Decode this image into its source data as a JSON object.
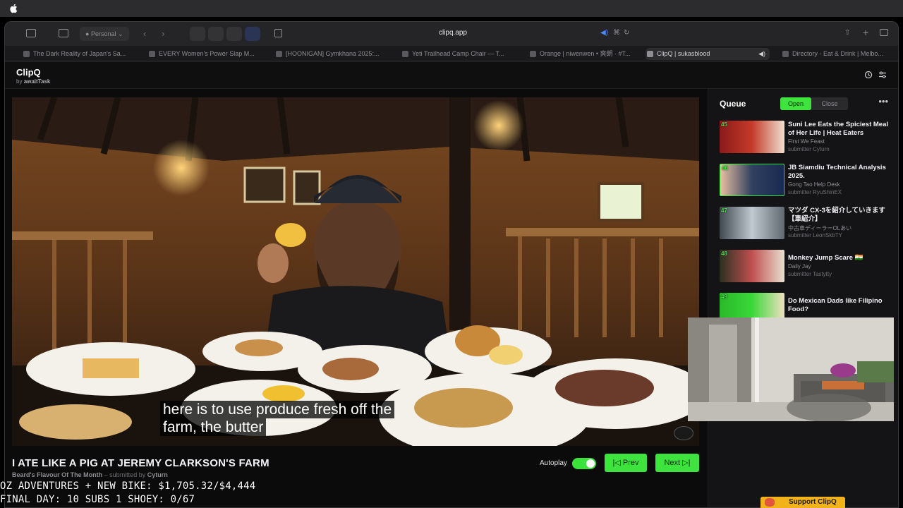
{
  "browser": {
    "profile_label": "Personal",
    "url": "clipq.app",
    "tabs": [
      {
        "label": "The Dark Reality of Japan's Sa..."
      },
      {
        "label": "EVERY Women's Power Slap M..."
      },
      {
        "label": "[HOONIGAN] Gymkhana 2025:..."
      },
      {
        "label": "Yeti Trailhead Camp Chair — T..."
      },
      {
        "label": "Orange | niwenwen • 爽朗 · #T..."
      },
      {
        "label": "ClipQ | sukasblood"
      },
      {
        "label": "Directory - Eat & Drink | Melbo..."
      }
    ]
  },
  "app": {
    "name": "ClipQ",
    "by_prefix": "by",
    "by_author": "awaitTask"
  },
  "video": {
    "caption_line1": "here is to use produce fresh off the",
    "caption_line2": "farm, the butter",
    "title": "I ATE LIKE A PIG AT JEREMY CLARKSON'S FARM",
    "channel": "Beard's Flavour Of The Month",
    "submitted_by_label": "– submitted by",
    "submitter": "Cyturn",
    "autoplay_label": "Autoplay",
    "autoplay_on": true,
    "prev_label": "Prev",
    "next_label": "Next"
  },
  "queue": {
    "title": "Queue",
    "open_label": "Open",
    "close_label": "Close",
    "items": [
      {
        "num": "45",
        "title": "Suni Lee Eats the Spiciest Meal of Her Life | Heat Eaters",
        "channel": "First We Feast",
        "submitter": "submitter Cyturn"
      },
      {
        "num": "46",
        "title": "JB Siamdiu Technical Analysis 2025.",
        "channel": "Gong Tao Help Desk",
        "submitter": "submitter RyuShinEX"
      },
      {
        "num": "47",
        "title": "マツダ CX-3を紹介していきます【車紹介】",
        "channel": "中古車ディーラーOLあい",
        "submitter": "submitter LeonSkbTY"
      },
      {
        "num": "48",
        "title": "Monkey Jump Scare 🇮🇳",
        "channel": "Daily Jay",
        "submitter": "submitter Tastytty"
      },
      {
        "num": "49",
        "title": "Do Mexican Dads like Filipino Food?",
        "channel": "",
        "submitter": ""
      }
    ]
  },
  "overlay": {
    "line1": "OZ ADVENTURES + NEW BIKE: $1,705.32/$4,444",
    "line2": "FINAL DAY: 10 SUBS 1 SHOEY: 0/67",
    "support_label": "Support ClipQ"
  },
  "colors": {
    "accent_green": "#3ee33e",
    "background": "#0b0b0c"
  }
}
